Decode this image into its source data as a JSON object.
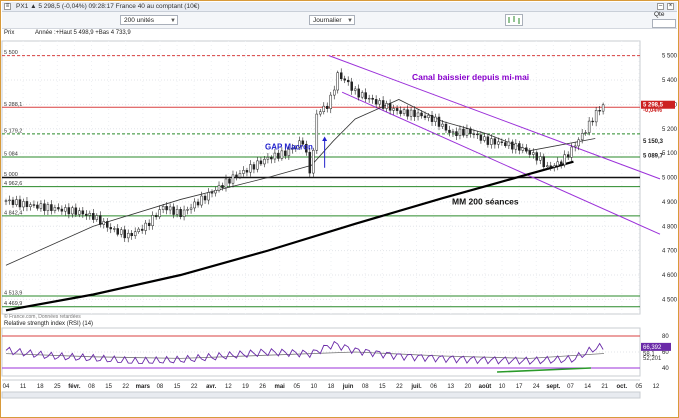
{
  "window": {
    "title": "PX1 ▲ 5 298,5 (-0,04%) 09:28:17 France 40 au comptant (10€)",
    "close_glyph": "×",
    "min_glyph": "–"
  },
  "toolbar": {
    "units_select": "200 unités",
    "period_select": "Journalier",
    "qte_label": "Qte"
  },
  "chart_data": [
    {
      "type": "line",
      "panel": "price",
      "legend_label": "Prix",
      "info_line": "Année :+Haut 5 498,9 +Bas 4 733,9",
      "source_note": "© France.com, Données retardées",
      "ylim": [
        4440,
        5560
      ],
      "y_ticks": [
        5500,
        5400,
        5300,
        5200,
        5100,
        5000,
        4900,
        4800,
        4700,
        4600,
        4500
      ],
      "y_tick_labels": [
        "5 500",
        "5 400",
        "5 300",
        "5 200",
        "5 100",
        "5 000",
        "4 900",
        "4 800",
        "4 700",
        "4 600",
        "4 500"
      ],
      "levels": [
        {
          "value": 5500,
          "label": "5 500",
          "style": "red-dash"
        },
        {
          "value": 5288.1,
          "label": "5 288,1",
          "style": "red"
        },
        {
          "value": 5179.2,
          "label": "5 179,2",
          "style": "green-dash"
        },
        {
          "value": 5084,
          "label": "5 084",
          "style": "green"
        },
        {
          "value": 5000,
          "label": "5 000",
          "style": "black"
        },
        {
          "value": 4962.6,
          "label": "4 962,6",
          "style": "green"
        },
        {
          "value": 4842.4,
          "label": "4 842,4",
          "style": "green"
        },
        {
          "value": 4513.9,
          "label": "4 513,9",
          "style": "green"
        },
        {
          "value": 4469.9,
          "label": "4 469,9",
          "style": "green"
        }
      ],
      "right_badges": [
        {
          "value": 5298.5,
          "label": "5 298,5",
          "color": "#cc2222"
        },
        {
          "value": 5276,
          "label": "-0,04%",
          "color": "#cc2222",
          "plain": true
        },
        {
          "value": 5150.3,
          "label": "5 150,3",
          "color": "#222222",
          "plain": true
        },
        {
          "value": 5089.7,
          "label": "5 089,7",
          "color": "#222222",
          "plain": true
        }
      ],
      "x_labels": [
        "04",
        "11",
        "18",
        "25",
        "févr.",
        "08",
        "15",
        "22",
        "mars",
        "08",
        "15",
        "22",
        "avr.",
        "12",
        "19",
        "26",
        "mai",
        "05",
        "10",
        "18",
        "juin",
        "08",
        "15",
        "22",
        "juil.",
        "06",
        "13",
        "20",
        "août",
        "10",
        "17",
        "24",
        "sept.",
        "07",
        "14",
        "21",
        "oct.",
        "05",
        "12"
      ],
      "x_major_labels": [
        "févr.",
        "mars",
        "avr.",
        "mai",
        "juin",
        "juil.",
        "août",
        "sept.",
        "oct."
      ],
      "series": [
        {
          "name": "MM 200 séances",
          "role": "sma200",
          "x": [
            0,
            40,
            80,
            120,
            160,
            200,
            220,
            240,
            260
          ],
          "values": [
            4455,
            4520,
            4600,
            4700,
            4810,
            4915,
            4965,
            5015,
            5065
          ]
        }
      ],
      "price_path": [
        [
          0,
          4905
        ],
        [
          8,
          4890
        ],
        [
          16,
          4880
        ],
        [
          24,
          4870
        ],
        [
          32,
          4860
        ],
        [
          40,
          4840
        ],
        [
          48,
          4790
        ],
        [
          56,
          4760
        ],
        [
          64,
          4800
        ],
        [
          72,
          4880
        ],
        [
          80,
          4850
        ],
        [
          88,
          4900
        ],
        [
          96,
          4950
        ],
        [
          104,
          5000
        ],
        [
          112,
          5040
        ],
        [
          120,
          5080
        ],
        [
          128,
          5100
        ],
        [
          136,
          5150
        ],
        [
          140,
          5000
        ],
        [
          142,
          5260
        ],
        [
          148,
          5300
        ],
        [
          152,
          5420
        ],
        [
          156,
          5395
        ],
        [
          160,
          5350
        ],
        [
          166,
          5325
        ],
        [
          172,
          5300
        ],
        [
          180,
          5270
        ],
        [
          188,
          5260
        ],
        [
          196,
          5240
        ],
        [
          204,
          5180
        ],
        [
          212,
          5190
        ],
        [
          220,
          5150
        ],
        [
          228,
          5140
        ],
        [
          236,
          5120
        ],
        [
          244,
          5080
        ],
        [
          248,
          5040
        ],
        [
          254,
          5060
        ],
        [
          258,
          5100
        ],
        [
          262,
          5150
        ],
        [
          266,
          5200
        ],
        [
          270,
          5260
        ],
        [
          274,
          5300
        ]
      ],
      "sma50": {
        "x": [
          0,
          40,
          80,
          120,
          140,
          150,
          160,
          180,
          200,
          220,
          240,
          270
        ],
        "values": [
          4640,
          4800,
          4910,
          5000,
          5050,
          5150,
          5240,
          5320,
          5230,
          5180,
          5110,
          5160
        ]
      },
      "annotations": [
        {
          "text": "Canal baissier depuis mi-mai",
          "color": "#8800cc"
        },
        {
          "text": "GAP Macron",
          "color": "#2222cc"
        },
        {
          "text": "MM 200 séances",
          "color": "#111111"
        }
      ],
      "channel_upper": [
        [
          148,
          5500
        ],
        [
          274,
          5080
        ]
      ],
      "channel_lower": [
        [
          154,
          5350
        ],
        [
          274,
          4870
        ]
      ]
    },
    {
      "type": "line",
      "panel": "rsi",
      "title": "Relative strength index (RSI) (14)",
      "ylim": [
        30,
        90
      ],
      "y_ticks": [
        80,
        60,
        40
      ],
      "y_tick_labels": [
        "80",
        "60",
        "40"
      ],
      "right_labels": [
        "66,392",
        "58,1",
        "52,201"
      ],
      "series": [
        {
          "name": "RSI",
          "x": [
            0,
            20,
            40,
            60,
            80,
            100,
            120,
            140,
            150,
            160,
            180,
            200,
            220,
            240,
            260,
            270,
            274
          ],
          "values": [
            62,
            55,
            52,
            48,
            50,
            55,
            60,
            58,
            70,
            62,
            55,
            52,
            50,
            49,
            51,
            65,
            66.4
          ]
        },
        {
          "name": "signal",
          "x": [
            0,
            40,
            80,
            120,
            160,
            200,
            240,
            274
          ],
          "values": [
            58,
            54,
            52,
            56,
            60,
            55,
            52,
            58.1
          ]
        }
      ],
      "trendline": [
        [
          225,
          35
        ],
        [
          268,
          40
        ]
      ]
    }
  ]
}
